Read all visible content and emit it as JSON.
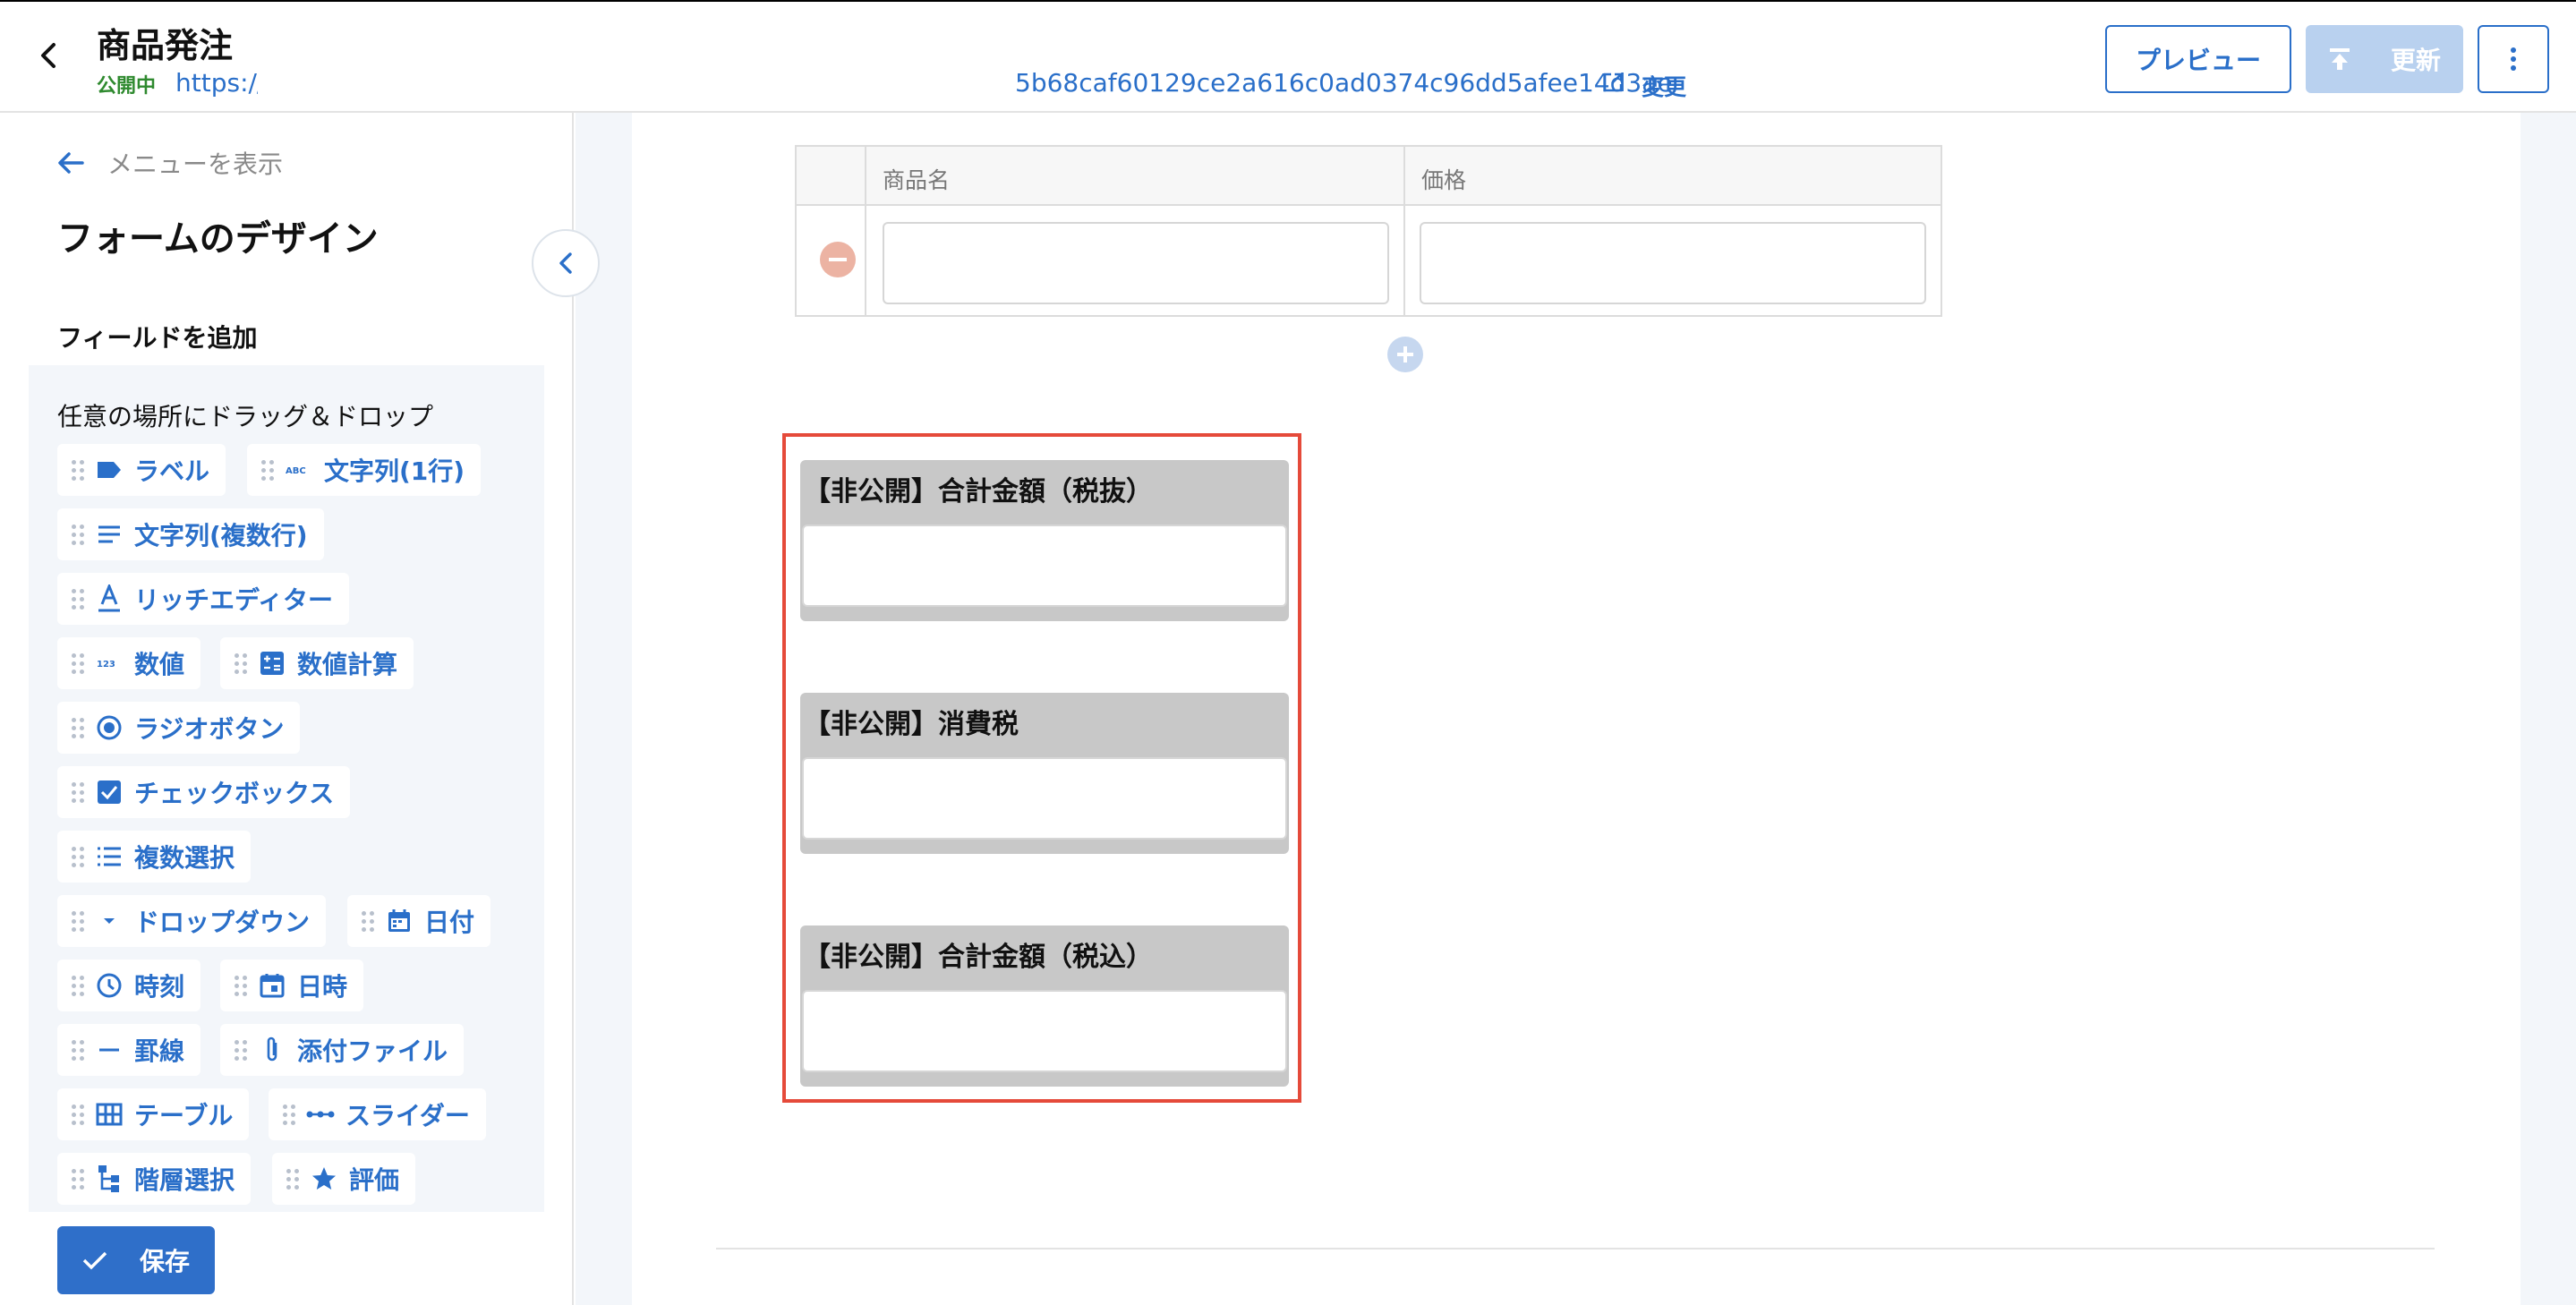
{
  "header": {
    "title": "商品発注",
    "status": "公開中",
    "url_prefix": "https://",
    "url_hash": "5b68caf60129ce2a616c0ad0374c96dd5afee14d3ae",
    "change_label": "変更",
    "preview_label": "プレビュー",
    "update_label": "更新"
  },
  "sidebar": {
    "show_menu_label": "メニューを表示",
    "title": "フォームのデザイン",
    "add_field_title": "フィールドを追加",
    "palette_hint": "任意の場所にドラッグ＆ドロップ",
    "items": [
      {
        "label": "ラベル",
        "icon": "label-icon"
      },
      {
        "label": "文字列(1行)",
        "icon": "abc-icon"
      },
      {
        "label": "文字列(複数行)",
        "icon": "lines-icon"
      },
      {
        "label": "リッチエディター",
        "icon": "text-format-icon"
      },
      {
        "label": "数値",
        "icon": "number-icon"
      },
      {
        "label": "数値計算",
        "icon": "calculator-icon"
      },
      {
        "label": "ラジオボタン",
        "icon": "radio-icon"
      },
      {
        "label": "チェックボックス",
        "icon": "checkbox-icon"
      },
      {
        "label": "複数選択",
        "icon": "list-icon"
      },
      {
        "label": "ドロップダウン",
        "icon": "dropdown-icon"
      },
      {
        "label": "日付",
        "icon": "calendar-icon"
      },
      {
        "label": "時刻",
        "icon": "clock-icon"
      },
      {
        "label": "日時",
        "icon": "datetime-icon"
      },
      {
        "label": "罫線",
        "icon": "rule-icon"
      },
      {
        "label": "添付ファイル",
        "icon": "paperclip-icon"
      },
      {
        "label": "テーブル",
        "icon": "table-icon"
      },
      {
        "label": "スライダー",
        "icon": "slider-icon"
      },
      {
        "label": "階層選択",
        "icon": "hierarchy-icon"
      },
      {
        "label": "評価",
        "icon": "star-icon"
      }
    ],
    "save_label": "保存"
  },
  "canvas": {
    "table": {
      "columns": [
        "商品名",
        "価格"
      ]
    },
    "fields": [
      {
        "label": "【非公開】合計金額（税抜）"
      },
      {
        "label": "【非公開】消費税"
      },
      {
        "label": "【非公開】合計金額（税込）"
      }
    ]
  },
  "colors": {
    "accent": "#2a6fc9",
    "status_green": "#2f8a2f",
    "highlight_red": "#e54a3a",
    "disabled_button": "#b9d1ef"
  }
}
